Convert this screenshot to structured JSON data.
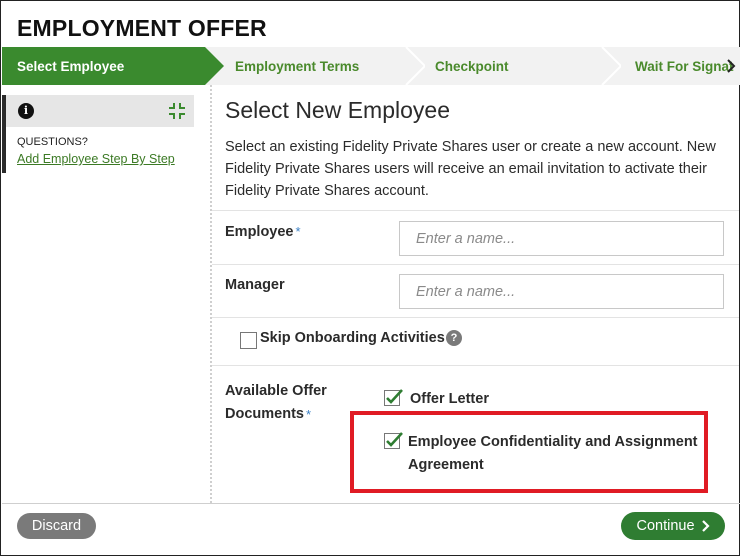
{
  "page": {
    "title": "EMPLOYMENT OFFER"
  },
  "stepper": {
    "steps": [
      {
        "label": "Select Employee"
      },
      {
        "label": "Employment Terms"
      },
      {
        "label": "Checkpoint"
      },
      {
        "label": "Wait For Signat"
      }
    ]
  },
  "help_panel": {
    "questions_label": "QUESTIONS?",
    "link_text": "Add Employee Step By Step",
    "info_icon_glyph": "i"
  },
  "main": {
    "heading": "Select New Employee",
    "description": "Select an existing Fidelity Private Shares user or create a new account. New Fidelity Private Shares users will receive an email invitation to activate their Fidelity Private Shares account.",
    "employee": {
      "label": "Employee",
      "required_mark": "*",
      "placeholder": "Enter a name...",
      "value": ""
    },
    "manager": {
      "label": "Manager",
      "placeholder": "Enter a name...",
      "value": ""
    },
    "skip_onboarding": {
      "label": "Skip Onboarding Activities",
      "checked": false,
      "help_glyph": "?"
    },
    "offer_documents": {
      "label_line1": "Available Offer",
      "label_line2": "Documents",
      "required_mark": "*",
      "items": [
        {
          "label_line1": "Offer Letter",
          "label_line2": "",
          "checked": true
        },
        {
          "label_line1": "Employee Confidentiality and Assignment",
          "label_line2": "Agreement",
          "checked": true
        }
      ]
    }
  },
  "footer": {
    "discard_label": "Discard",
    "continue_label": "Continue"
  },
  "colors": {
    "accent_green": "#2f7d32",
    "step_active": "#3a8a2e",
    "highlight_red": "#e01b24",
    "link_green": "#3c7a25"
  }
}
